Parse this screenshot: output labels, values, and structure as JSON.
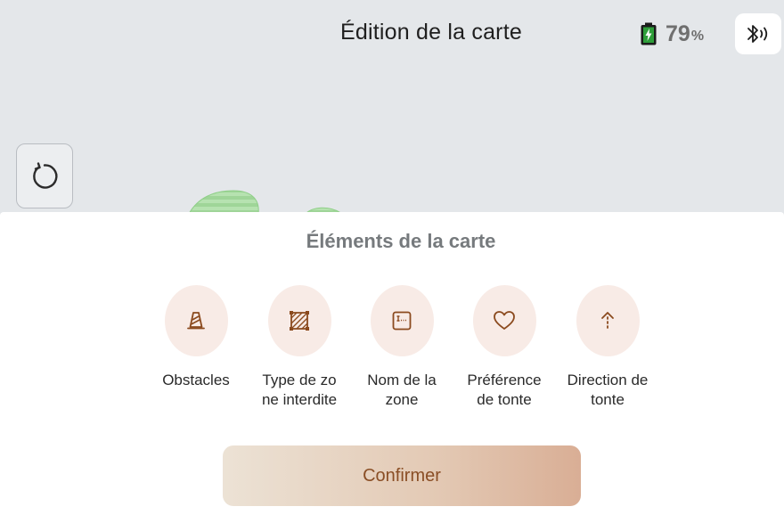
{
  "header": {
    "title": "Édition de la carte",
    "battery_value": "79",
    "battery_unit": "%"
  },
  "icons": {
    "bluetooth": "bluetooth-icon",
    "battery": "battery-charging-icon",
    "refresh": "refresh-icon"
  },
  "colors": {
    "accent_text": "#8a4e25",
    "icon_circle": "#f8ebe6",
    "icon_stroke": "#8b4a1e",
    "map_background": "#e4e7ea",
    "battery_green": "#2e9e3a",
    "zone_green": "#a6dba0"
  },
  "sheet": {
    "title": "Éléments de la carte",
    "items": [
      {
        "label": "Obstacles",
        "icon": "cone-icon"
      },
      {
        "label": "Type de zone interdite",
        "icon": "forbidden-zone-icon"
      },
      {
        "label": "Nom de la zone",
        "icon": "zone-name-icon"
      },
      {
        "label": "Préférence de tonte",
        "icon": "heart-icon"
      },
      {
        "label": "Direction de tonte",
        "icon": "direction-arrow-icon"
      }
    ],
    "confirm_label": "Confirmer"
  }
}
